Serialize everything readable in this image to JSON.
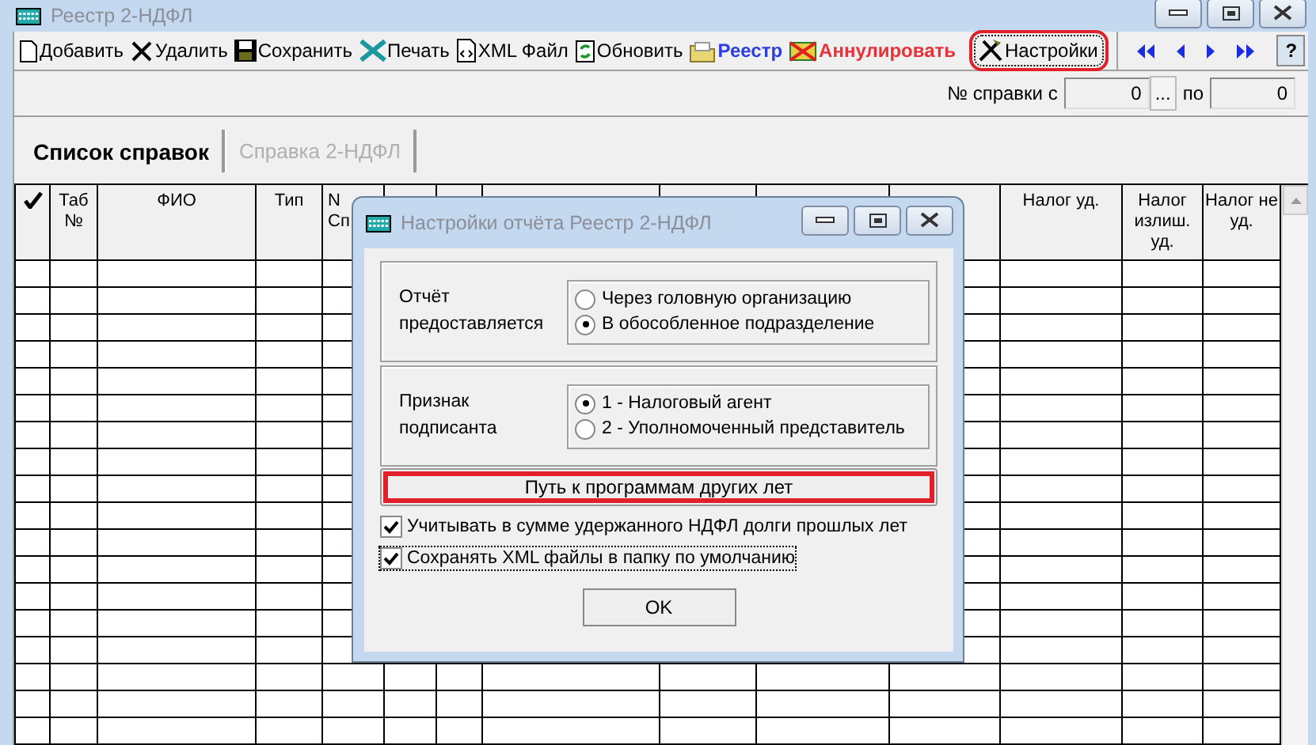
{
  "window": {
    "title": "Реестр 2-НДФЛ"
  },
  "toolbar": {
    "items": [
      {
        "kind": "add",
        "label": "Добавить",
        "color": "#000000",
        "highlighted": false
      },
      {
        "kind": "delete",
        "label": "Удалить",
        "color": "#000000",
        "highlighted": false
      },
      {
        "kind": "save",
        "label": "Сохранить",
        "color": "#000000",
        "highlighted": false
      },
      {
        "kind": "print",
        "label": "Печать",
        "color": "#000000",
        "highlighted": false
      },
      {
        "kind": "xml",
        "label": "XML Файл",
        "color": "#000000",
        "highlighted": false
      },
      {
        "kind": "refresh",
        "label": "Обновить",
        "color": "#000000",
        "highlighted": false
      },
      {
        "kind": "registry",
        "label": "Реестр",
        "color": "#2b3de0",
        "highlighted": false
      },
      {
        "kind": "cancel",
        "label": "Аннулировать",
        "color": "#e8323a",
        "highlighted": false
      },
      {
        "kind": "settings",
        "label": "Настройки",
        "color": "#000000",
        "highlighted": true
      }
    ],
    "help": "?"
  },
  "range": {
    "label": "№ справки с",
    "from": "0",
    "browse": "...",
    "to_label": "по",
    "to": "0"
  },
  "tabs": [
    {
      "label": "Список справок",
      "selected": true
    },
    {
      "label": "Справка 2-НДФЛ",
      "selected": false
    }
  ],
  "table": {
    "columns": [
      {
        "kind": "check"
      },
      {
        "kind": "text",
        "label": "Таб №"
      },
      {
        "kind": "text",
        "label": "ФИО"
      },
      {
        "kind": "text",
        "label": "Тип"
      },
      {
        "kind": "cut",
        "label": "N Сп"
      },
      {
        "kind": "hidden"
      },
      {
        "kind": "hidden"
      },
      {
        "kind": "hidden"
      },
      {
        "kind": "hidden"
      },
      {
        "kind": "hidden"
      },
      {
        "kind": "hidden"
      },
      {
        "kind": "text",
        "label": "Налог уд."
      },
      {
        "kind": "text",
        "label": "Налог излиш. уд."
      },
      {
        "kind": "text",
        "label": "Налог не уд."
      }
    ]
  },
  "dialog": {
    "title": "Настройки отчёта Реестр 2-НДФЛ",
    "groups": [
      {
        "label": "Отчёт предоставляется",
        "options": [
          {
            "label": "Через головную организацию",
            "selected": false
          },
          {
            "label": "В обособленное подразделение",
            "selected": true
          }
        ]
      },
      {
        "label": "Признак подписанта",
        "options": [
          {
            "label": "1 - Налоговый агент",
            "selected": true
          },
          {
            "label": "2 - Уполномоченный представитель",
            "selected": false
          }
        ]
      }
    ],
    "path_button": {
      "label": "Путь к программам других лет",
      "highlighted": true
    },
    "checkboxes": [
      {
        "label": "Учитывать в сумме удержанного НДФЛ долги прошлых лет",
        "checked": true,
        "focused": false
      },
      {
        "label": "Сохранять XML файлы в папку по умолчанию",
        "checked": true,
        "focused": true
      }
    ],
    "ok": "OK"
  }
}
